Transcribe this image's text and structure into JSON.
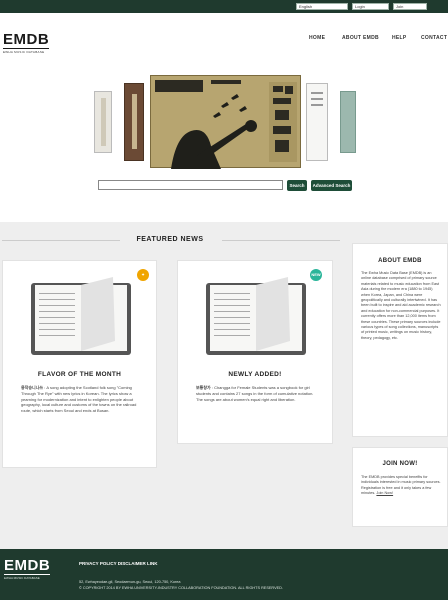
{
  "topbar": {
    "language_value": "English",
    "login_value": "Login",
    "join_value": "Join"
  },
  "header": {
    "logo_text": "EMDB",
    "logo_subtitle": "EWHA MUSIC DATABASE",
    "nav": [
      {
        "label": "HOME"
      },
      {
        "label": "ABOUT EMDB"
      },
      {
        "label": "HELP"
      },
      {
        "label": "CONTACT"
      }
    ]
  },
  "search": {
    "placeholder": "",
    "search_label": "Search",
    "advanced_label": "Advanced Search"
  },
  "featured": {
    "title": "FEATURED NEWS",
    "cards": [
      {
        "title": "FLAVOR OF THE MONTH",
        "badge": "",
        "badge_color": "#f0a500",
        "body_lead": "용작승니나쓰",
        "body": " : A song adopting the Scotland folk song \"Coming Through The Rye\" with new lyrics in Korean. The lyrics show a yearning for modernization and intent to enlighten people about geography, local culture and customs of the towns on the railroad route, which starts from Seoul and ends at Busan."
      },
      {
        "title": "NEWLY ADDED!",
        "badge": "NEW",
        "badge_color": "#2bb59a",
        "body_lead": "보통창가",
        "body": " : Changga for Female Students was a songbook for girl students and contains 27 songs in the form of cumulative notation. The songs are about women's equal right and liberation."
      }
    ]
  },
  "about": {
    "title": "ABOUT EMDB",
    "body": "The Ewha Music Data Base (EMDB) is an online database comprised of primary source materials related to music education from East Asia during the modern era (1880 to 1945) when Korea, Japan, and China were geopolitically and culturally intertwined. It has been built to inspire and aid academic research and education for non-commercial purposes. It currently offers more than 12,000 items from these countries. These primary sources include various types of song collections, manuscripts of printed music, writings on music history, theory, pedagogy, etc."
  },
  "join": {
    "title": "JOIN NOW!",
    "body": "The EMDB provides special benefits for individuals interested in music primary sources. Registration is free and it only takes a few minutes.",
    "link": "Join Now!"
  },
  "footer": {
    "logo_text": "EMDB",
    "logo_subtitle": "EWHA MUSIC DATABASE",
    "links": "PRIVACY POLICY  DISCLAIMER  LINK",
    "address": "52, Ewhayeodae-gil, Seodaemun-gu, Seoul, 120-750, Korea",
    "copyright": "© COPYRIGHT 2014 BY EWHA UNIVERSITY-INDUSTRY COLLABORATION FOUNDATION. ALL RIGHTS RESERVED."
  },
  "colors": {
    "brand_dark_green": "#1f3a2e",
    "button_green": "#1e4d38",
    "flavor_badge": "#f0a500",
    "new_badge": "#2bb59a"
  }
}
